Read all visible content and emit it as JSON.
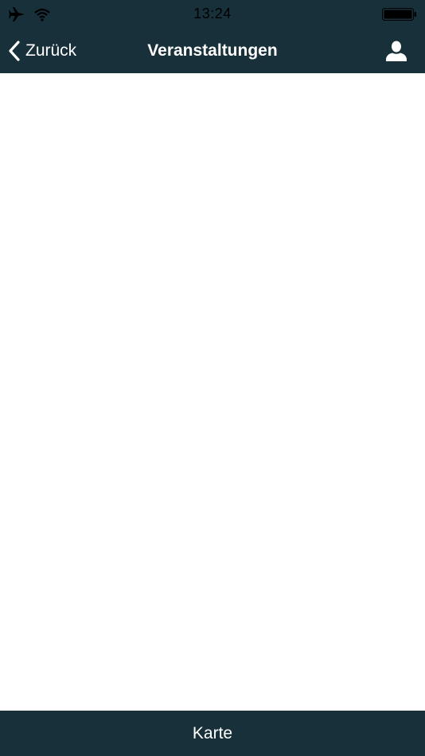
{
  "status_bar": {
    "time": "13:24",
    "icons": [
      "airplane-mode-icon",
      "wifi-icon",
      "battery-icon"
    ]
  },
  "nav_bar": {
    "back_label": "Zurück",
    "title": "Veranstaltungen",
    "profile_icon": "person-icon"
  },
  "bottom_bar": {
    "label": "Karte"
  },
  "colors": {
    "bar_background": "#17303a",
    "bar_text": "#ffffff",
    "content_background": "#ffffff"
  }
}
